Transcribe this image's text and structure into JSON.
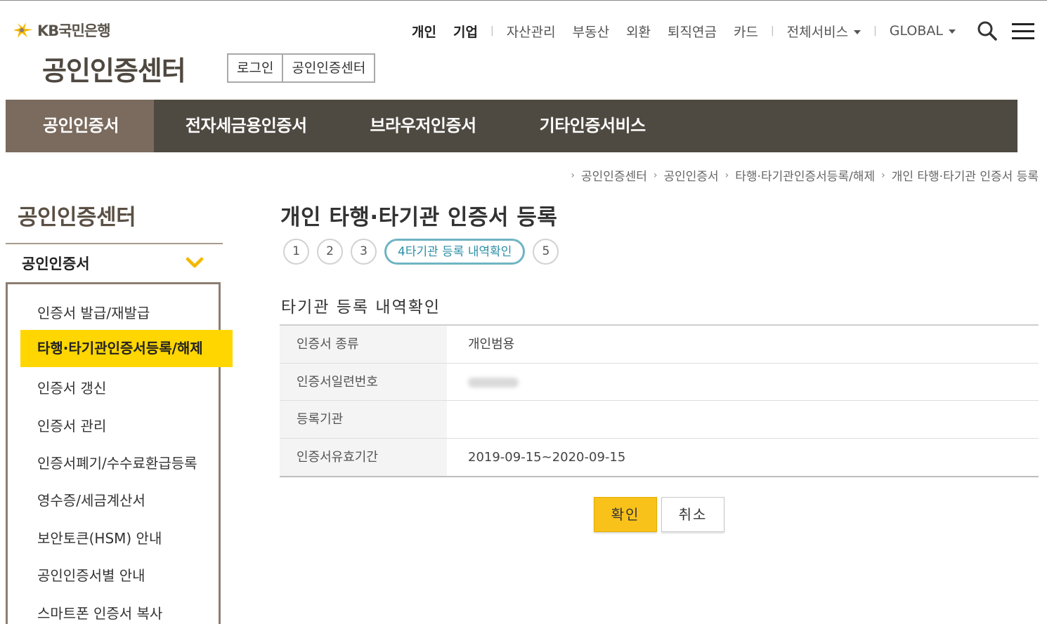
{
  "header": {
    "logo_text": "KB국민은행",
    "site_title": "공인인증센터",
    "sub_buttons": [
      "로그인",
      "공인인증센터"
    ],
    "top_nav": {
      "personal": "개인",
      "business": "기업",
      "asset": "자산관리",
      "realestate": "부동산",
      "forex": "외환",
      "pension": "퇴직연금",
      "card": "카드",
      "all_services": "전체서비스",
      "global": "GLOBAL"
    }
  },
  "main_nav": [
    "공인인증서",
    "전자세금용인증서",
    "브라우저인증서",
    "기타인증서비스"
  ],
  "breadcrumb": [
    "공인인증센터",
    "공인인증서",
    "타행·타기관인증서등록/해제",
    "개인 타행·타기관 인증서 등록"
  ],
  "sidebar": {
    "title": "공인인증센터",
    "section": "공인인증서",
    "items": [
      "인증서 발급/재발급",
      "타행·타기관인증서등록/해제",
      "인증서 갱신",
      "인증서 관리",
      "인증서폐기/수수료환급등록",
      "영수증/세금계산서",
      "보안토큰(HSM) 안내",
      "공인인증서별 안내",
      "스마트폰 인증서 복사"
    ]
  },
  "content": {
    "page_title": "개인 타행·타기관 인증서 등록",
    "steps": [
      "1",
      "2",
      "3",
      "4타기관 등록 내역확인",
      "5"
    ],
    "section_title": "타기관 등록 내역확인",
    "table": [
      {
        "label": "인증서 종류",
        "value": "개인범용"
      },
      {
        "label": "인증서일련번호",
        "value": ""
      },
      {
        "label": "등록기관",
        "value": ""
      },
      {
        "label": "인증서유효기간",
        "value": "2019-09-15~2020-09-15"
      }
    ],
    "buttons": {
      "confirm": "확인",
      "cancel": "취소"
    }
  },
  "colors": {
    "nav_bg": "#4f4a41",
    "nav_active": "#7a6b5e",
    "highlight": "#ffd600",
    "confirm_button": "#f9c21b",
    "step_active": "#6fb4c3"
  }
}
